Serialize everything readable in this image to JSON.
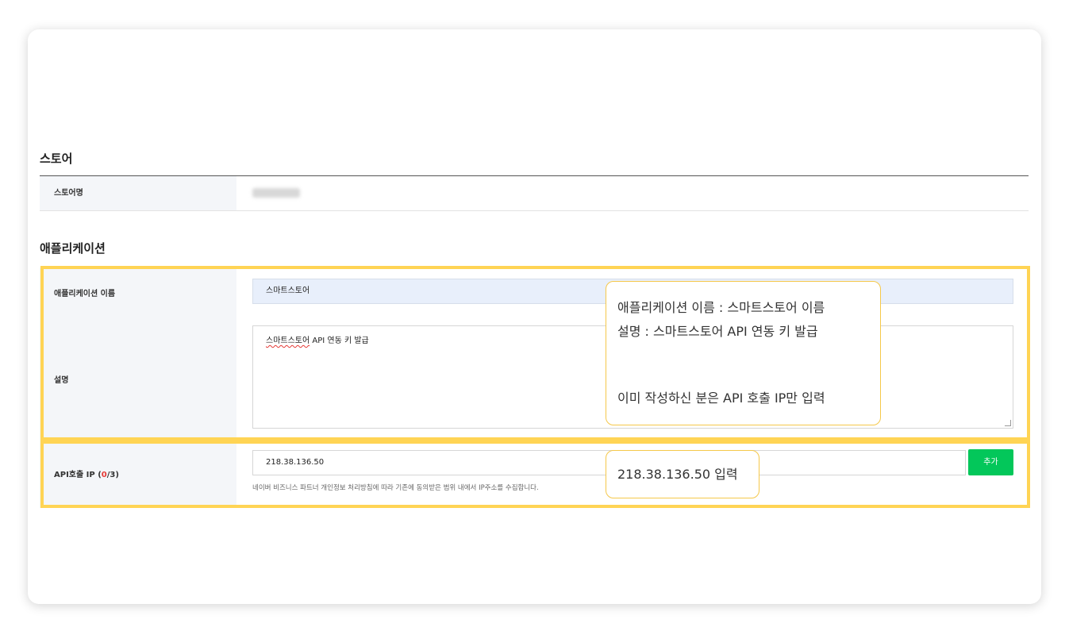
{
  "store_section": {
    "title": "스토어",
    "name_label": "스토어명"
  },
  "app_section": {
    "title": "애플리케이션",
    "name_label": "애플리케이션 이름",
    "name_value": "스마트스토어",
    "desc_label": "설명",
    "desc_value_prefix": "스마트스토어",
    "desc_value_rest": " API 연동 키 발급",
    "ip_label_prefix": "API호출 IP (",
    "ip_label_count": "0",
    "ip_label_suffix": "/3)",
    "ip_value": "218.38.136.50",
    "add_button": "추가",
    "ip_notice": "네이버 비즈니스 파트너 개인정보 처리방침에 따라 기존에 동의받은 범위 내에서 IP주소를 수집합니다."
  },
  "callouts": {
    "first_line1": "애플리케이션 이름 : 스마트스토어 이름",
    "first_line2": "설명 : 스마트스토어 API 연동 키 발급",
    "first_line3": "이미 작성하신 분은 API 호출 IP만 입력",
    "second": "218.38.136.50 입력"
  },
  "colors": {
    "highlight": "#ffd454",
    "add_button": "#03c75a",
    "required_red": "#e53935"
  }
}
